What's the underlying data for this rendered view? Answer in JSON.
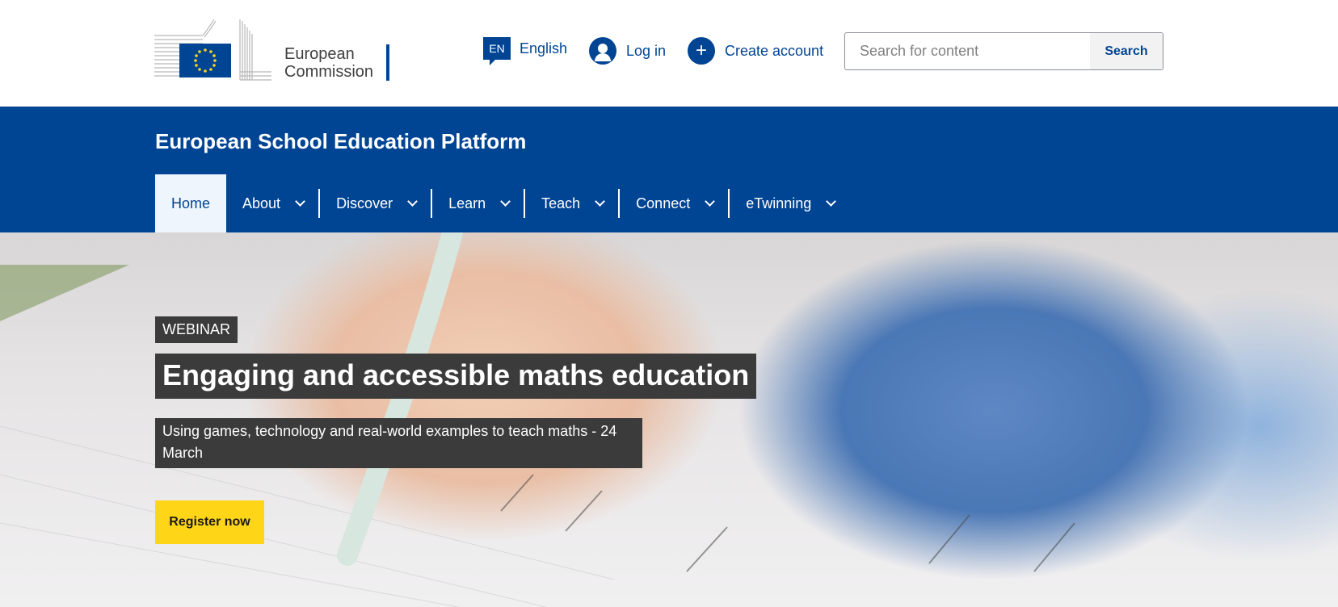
{
  "header": {
    "logo_line1": "European",
    "logo_line2": "Commission",
    "language_code": "EN",
    "language_label": "English",
    "login_label": "Log in",
    "create_account_label": "Create account",
    "search_placeholder": "Search for content",
    "search_button": "Search"
  },
  "site": {
    "title": "European School Education Platform"
  },
  "nav": {
    "items": [
      {
        "label": "Home",
        "active": true
      },
      {
        "label": "About"
      },
      {
        "label": "Discover"
      },
      {
        "label": "Learn"
      },
      {
        "label": "Teach"
      },
      {
        "label": "Connect"
      },
      {
        "label": "eTwinning"
      }
    ]
  },
  "hero": {
    "tag": "WEBINAR",
    "headline": "Engaging and accessible maths education",
    "subtitle": "Using games, technology and real-world examples to teach maths - 24 March",
    "cta": "Register now"
  },
  "colors": {
    "brand_blue": "#004494",
    "cta_yellow": "#ffd617",
    "active_tab_bg": "#eef5fc"
  }
}
